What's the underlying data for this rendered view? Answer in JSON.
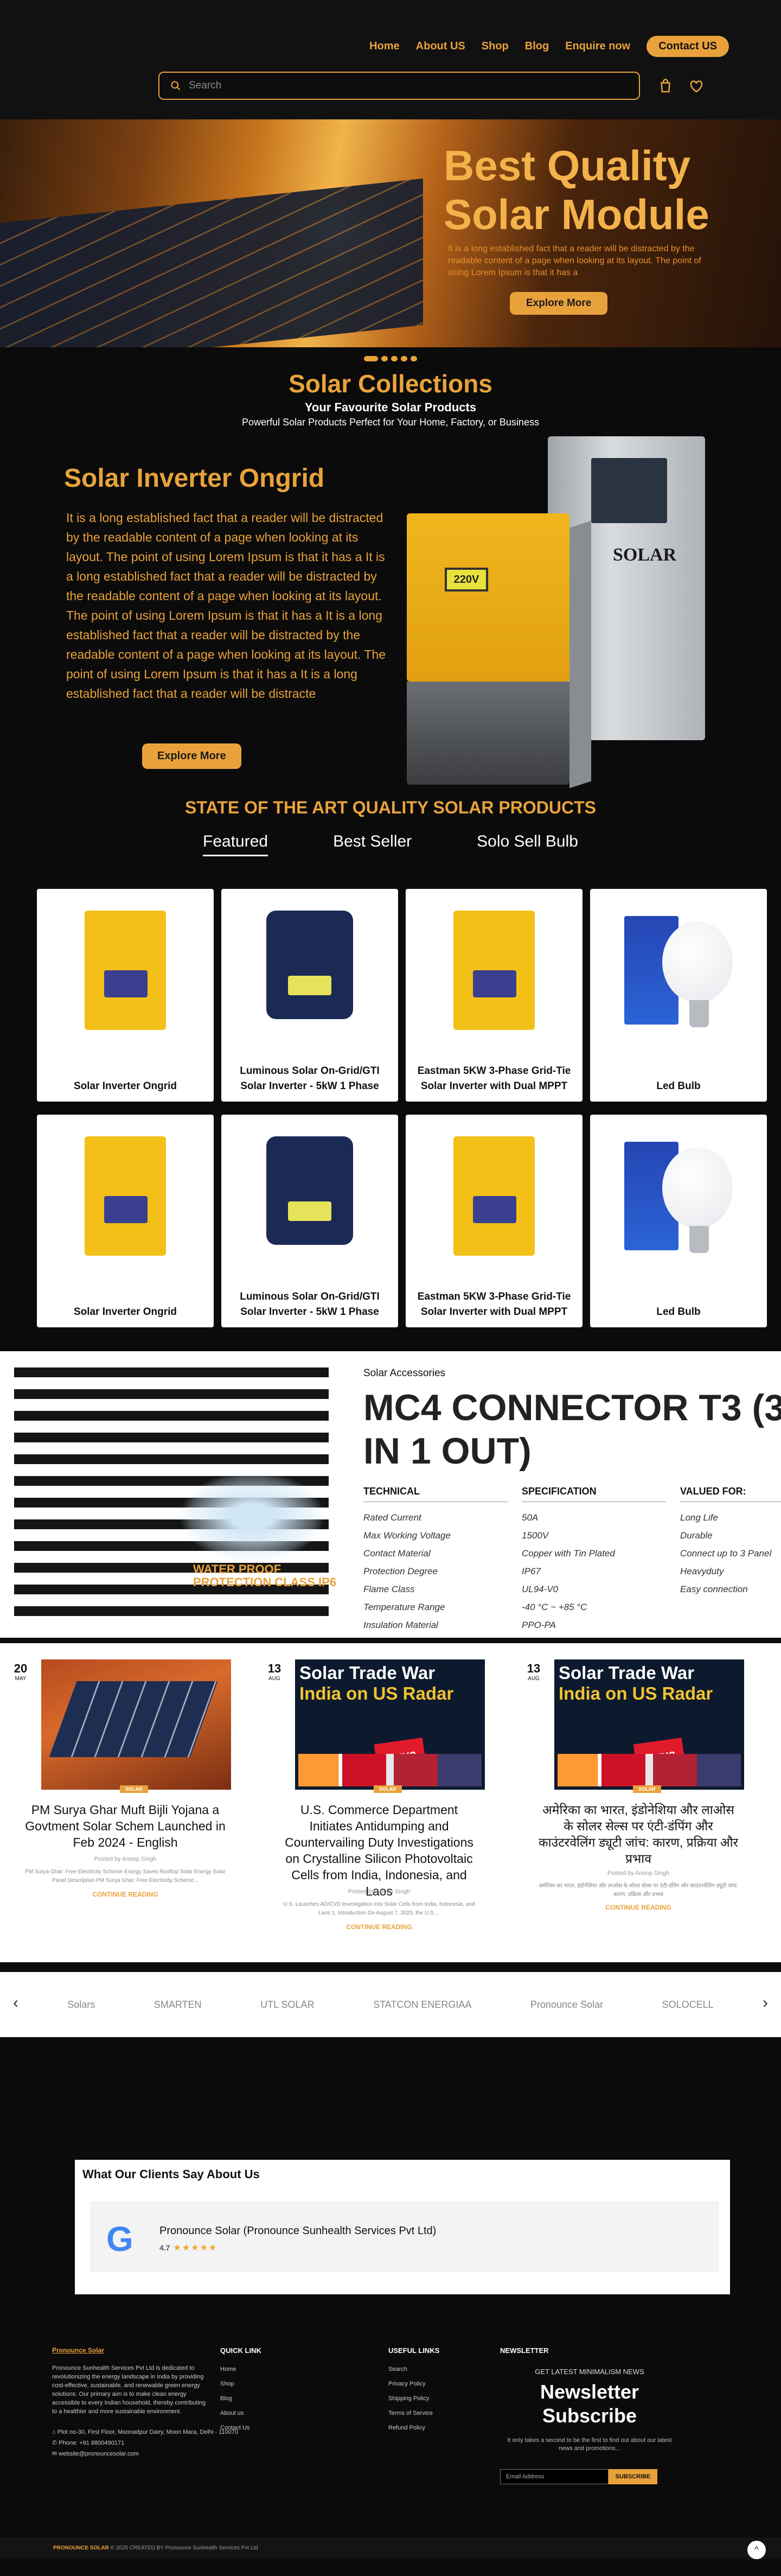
{
  "nav": {
    "links": [
      "Home",
      "About US",
      "Shop",
      "Blog",
      "Enquire now"
    ],
    "contact": "Contact US"
  },
  "search": {
    "placeholder": "Search"
  },
  "hero": {
    "title_line1": "Best Quality",
    "title_line2": "Solar Module",
    "text": "It is a long established fact that a reader will be distracted by the readable content of a page when looking at its layout. The point of using Lorem Ipsum is that it has a",
    "button": "Explore More"
  },
  "collections": {
    "title": "Solar Collections",
    "subtitle": "Your Favourite Solar Products",
    "tagline": "Powerful Solar Products Perfect for Your Home, Factory, or Business"
  },
  "feature": {
    "title": "Solar Inverter Ongrid",
    "text": "It is a long established fact that a reader will be distracted by the readable content of a page when looking at its layout. The point of using Lorem Ipsum is that it has a It is a long established fact that a reader will be distracted by the readable content of a page when looking at its layout. The point of using Lorem Ipsum is that it has a It is a long established fact that a reader will be distracted by the readable content of a page when looking at its layout. The point of using Lorem Ipsum is that it has a It is a long established fact that a reader will be distracte",
    "button": "Explore More",
    "back_label": "SOLAR",
    "lcd": "220V"
  },
  "products": {
    "heading": "STATE OF THE ART QUALITY SOLAR PRODUCTS",
    "tabs": [
      "Featured",
      "Best Seller",
      "Solo Sell Bulb"
    ],
    "items": [
      "Solar Inverter Ongrid",
      "Luminous Solar On-Grid/GTI Solar Inverter - 5kW 1 Phase",
      "Eastman 5KW 3-Phase Grid-Tie Solar Inverter with Dual MPPT",
      "Led Bulb",
      "Solar Inverter Ongrid",
      "Luminous Solar On-Grid/GTI Solar Inverter - 5kW 1 Phase",
      "Eastman 5KW 3-Phase Grid-Tie Solar Inverter with Dual MPPT",
      "Led Bulb"
    ]
  },
  "mc4": {
    "category": "Solar Accessories",
    "title_line1": "MC4 CONNECTOR T3 (3",
    "title_line2": "IN 1 OUT)",
    "img_text_line1": "WATER PROOF",
    "img_text_line2": "PROTECTION CLASS   IP6",
    "headers": [
      "TECHNICAL",
      "SPECIFICATION",
      "VALUED FOR:"
    ],
    "technical": [
      "Rated Current",
      "Max Working Voltage",
      "Contact Material",
      "Protection Degree",
      "Flame Class",
      "Temperature Range",
      "Insulation Material"
    ],
    "specification": [
      "50A",
      "1500V",
      "Copper with Tin Plated",
      "IP67",
      "UL94-V0",
      "-40 °C ~ +85 °C",
      "PPO-PA"
    ],
    "valued": [
      "Long Life",
      "Durable",
      "Connect up to 3 Panel",
      "Heavyduty",
      "Easy connection"
    ]
  },
  "news": [
    {
      "day": "20",
      "month": "MAY",
      "tag": "SOLAR",
      "title": "PM Surya Ghar Muft Bijli Yojana a Govtment Solar Schem Launched in Feb 2024 - English",
      "by": "Posted by Anoop Singh",
      "excerpt": "PM Surya Ghar: Free Electricity Scheme Energy Saves Rooftop Solar Energy Solar Panel Description PM Surya Ghar: Free Electricity Scheme...",
      "read": "CONTINUE READING"
    },
    {
      "day": "13",
      "month": "AUG",
      "tag": "SOLAR",
      "img_title1": "Solar Trade War",
      "img_title2": "India on US Radar",
      "title": "U.S. Commerce Department Initiates Antidumping and Countervailing Duty Investigations on Crystalline Silicon Photovoltaic Cells from India, Indonesia, and Laos",
      "by": "Posted by Anoop Singh",
      "excerpt": "U.S. Launches AD/CVD Investigation into Solar Cells from India, Indonesia, and Laos 1. Introduction On August 7, 2025, the U.S....",
      "read": "CONTINUE READING"
    },
    {
      "day": "13",
      "month": "AUG",
      "tag": "SOLAR",
      "img_title1": "Solar Trade War",
      "img_title2": "India on US Radar",
      "title": "अमेरिका का भारत, इंडोनेशिया और लाओस के सोलर सेल्स पर एंटी-डंपिंग और काउंटरवेलिंग ड्यूटी जांच: कारण, प्रक्रिया और प्रभाव",
      "by": "Posted by Anoop Singh",
      "excerpt": "अमेरिका का भारत, इंडोनेशिया और लाओस के सोलर सेल्स पर एंटी-डंपिंग और काउंटरवेलिंग ड्यूटी जांच: कारण, प्रक्रिया और प्रभाव",
      "read": "CONTINUE READING"
    }
  ],
  "logos": [
    "Solars",
    "SMARTEN",
    "UTL SOLAR",
    "STATCON ENERGIAA",
    "Pronounce Solar",
    "SOLOCELL"
  ],
  "testimonial": {
    "heading": "What Our Clients Say About Us",
    "name": "Pronounce Solar (Pronounce Sunhealth Services Pvt Ltd)",
    "rating": "4.7",
    "stars": "★★★★★"
  },
  "footer": {
    "brand": "Pronounce Solar",
    "about": "Pronounce Sunhealth Services Pvt Ltd is dedicated to revolutionizing the energy landscape in India by providing cost-effective, sustainable, and renewable green energy solutions. Our primary aim is to make clean energy accessible to every Indian household, thereby contributing to a healthier and more sustainable environment.",
    "address": "Plot no-30, First Floor, Moonadpur Dairy, Moon Mara, Delhi - 110070",
    "phone": "Phone: +91 8800490171",
    "email": "website@pronouncesolar.com",
    "quick_title": "QUICK LINK",
    "quick": [
      "Home",
      "Shop",
      "Blog",
      "About us",
      "Contact Us"
    ],
    "useful_title": "USEFUL LINKS",
    "useful": [
      "Search",
      "Privacy Policy",
      "Shipping Policy",
      "Terms of Service",
      "Refund Policy"
    ],
    "nl_title": "NEWSLETTER",
    "nl_label": "GET LATEST MINIMALISM NEWS",
    "nl_big1": "Newsletter",
    "nl_big2": "Subscribe",
    "nl_small": "It only takes a second to be the first to find out about our latest news and promotions...",
    "nl_placeholder": "Email Address",
    "nl_button": "SUBSCRIBE",
    "copy_brand": "PRONOUNCE SOLAR",
    "copy_text": "© 2025 CREATED BY Pronounce Sunhealth Services Pvt Ltd"
  },
  "colors": {
    "accent": "#e9a23b",
    "background": "#0b0b0b"
  }
}
